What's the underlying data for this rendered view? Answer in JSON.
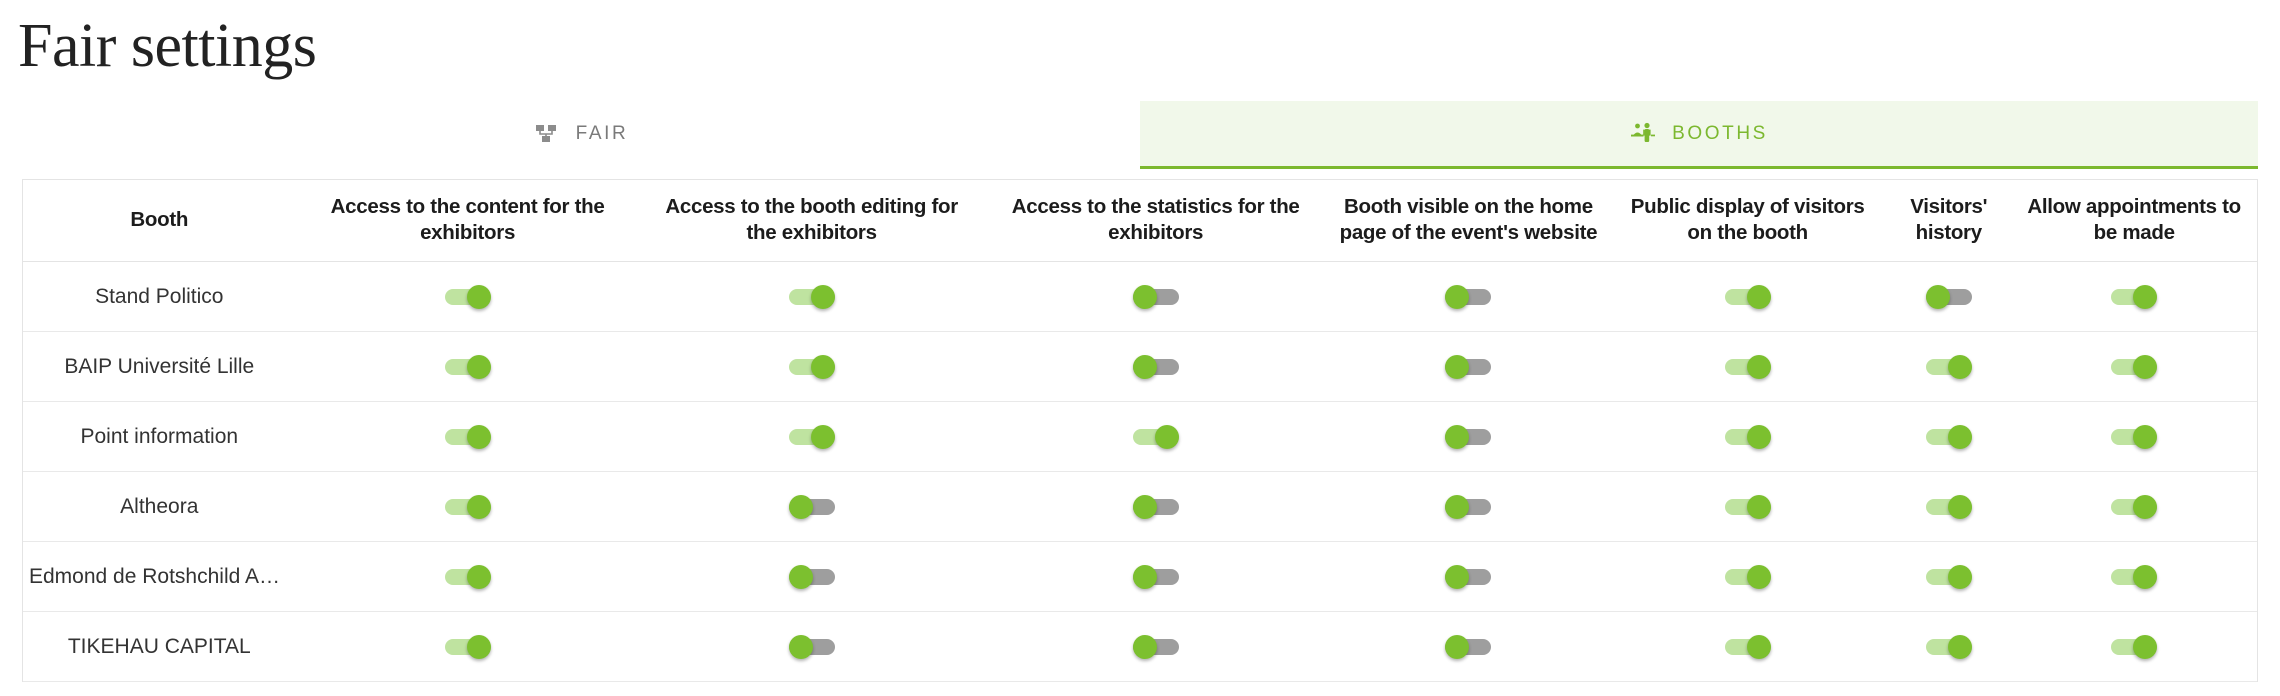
{
  "page": {
    "title": "Fair settings"
  },
  "tabs": [
    {
      "id": "fair",
      "label": "FAIR",
      "icon": "sitemap-icon",
      "active": false
    },
    {
      "id": "booths",
      "label": "BOOTHS",
      "icon": "booth-people-icon",
      "active": true
    }
  ],
  "colors": {
    "accent_green": "#7cb82f",
    "toggle_knob_green": "#7cc02f",
    "toggle_track_on": "#bfe3a0",
    "toggle_track_off": "#9e9e9e",
    "active_tab_bg": "#f1f8ea",
    "inactive_tab_text": "#7a7a7a",
    "border": "#e4e4e4"
  },
  "table": {
    "headers": [
      "Booth",
      "Access to the content for the exhibitors",
      "Access to the booth editing for the exhibitors",
      "Access to the statistics for the exhibitors",
      "Booth visible on the home page of the event's website",
      "Public display of visitors on the booth",
      "Visitors' history",
      "Allow appointments to be made"
    ],
    "rows": [
      {
        "booth": "Stand Politico",
        "toggles": [
          {
            "column": "Access to the content for the exhibitors",
            "state": "on"
          },
          {
            "column": "Access to the booth editing for the exhibitors",
            "state": "on"
          },
          {
            "column": "Access to the statistics for the exhibitors",
            "state": "off"
          },
          {
            "column": "Booth visible on the home page of the event's website",
            "state": "off"
          },
          {
            "column": "Public display of visitors on the booth",
            "state": "on"
          },
          {
            "column": "Visitors' history",
            "state": "off"
          },
          {
            "column": "Allow appointments to be made",
            "state": "on"
          }
        ]
      },
      {
        "booth": "BAIP Université Lille",
        "toggles": [
          {
            "column": "Access to the content for the exhibitors",
            "state": "on"
          },
          {
            "column": "Access to the booth editing for the exhibitors",
            "state": "on"
          },
          {
            "column": "Access to the statistics for the exhibitors",
            "state": "off"
          },
          {
            "column": "Booth visible on the home page of the event's website",
            "state": "off"
          },
          {
            "column": "Public display of visitors on the booth",
            "state": "on"
          },
          {
            "column": "Visitors' history",
            "state": "on"
          },
          {
            "column": "Allow appointments to be made",
            "state": "on"
          }
        ]
      },
      {
        "booth": "Point information",
        "toggles": [
          {
            "column": "Access to the content for the exhibitors",
            "state": "on"
          },
          {
            "column": "Access to the booth editing for the exhibitors",
            "state": "on"
          },
          {
            "column": "Access to the statistics for the exhibitors",
            "state": "on"
          },
          {
            "column": "Booth visible on the home page of the event's website",
            "state": "off"
          },
          {
            "column": "Public display of visitors on the booth",
            "state": "on"
          },
          {
            "column": "Visitors' history",
            "state": "on"
          },
          {
            "column": "Allow appointments to be made",
            "state": "on"
          }
        ]
      },
      {
        "booth": "Altheora",
        "toggles": [
          {
            "column": "Access to the content for the exhibitors",
            "state": "on"
          },
          {
            "column": "Access to the booth editing for the exhibitors",
            "state": "off"
          },
          {
            "column": "Access to the statistics for the exhibitors",
            "state": "off"
          },
          {
            "column": "Booth visible on the home page of the event's website",
            "state": "off"
          },
          {
            "column": "Public display of visitors on the booth",
            "state": "on"
          },
          {
            "column": "Visitors' history",
            "state": "on"
          },
          {
            "column": "Allow appointments to be made",
            "state": "on"
          }
        ]
      },
      {
        "booth": "Edmond de Rotshchild Asset ...",
        "toggles": [
          {
            "column": "Access to the content for the exhibitors",
            "state": "on"
          },
          {
            "column": "Access to the booth editing for the exhibitors",
            "state": "off"
          },
          {
            "column": "Access to the statistics for the exhibitors",
            "state": "off"
          },
          {
            "column": "Booth visible on the home page of the event's website",
            "state": "off"
          },
          {
            "column": "Public display of visitors on the booth",
            "state": "on"
          },
          {
            "column": "Visitors' history",
            "state": "on"
          },
          {
            "column": "Allow appointments to be made",
            "state": "on"
          }
        ]
      },
      {
        "booth": "TIKEHAU CAPITAL",
        "toggles": [
          {
            "column": "Access to the content for the exhibitors",
            "state": "on"
          },
          {
            "column": "Access to the booth editing for the exhibitors",
            "state": "off"
          },
          {
            "column": "Access to the statistics for the exhibitors",
            "state": "off"
          },
          {
            "column": "Booth visible on the home page of the event's website",
            "state": "off"
          },
          {
            "column": "Public display of visitors on the booth",
            "state": "on"
          },
          {
            "column": "Visitors' history",
            "state": "on"
          },
          {
            "column": "Allow appointments to be made",
            "state": "on"
          }
        ]
      }
    ]
  }
}
